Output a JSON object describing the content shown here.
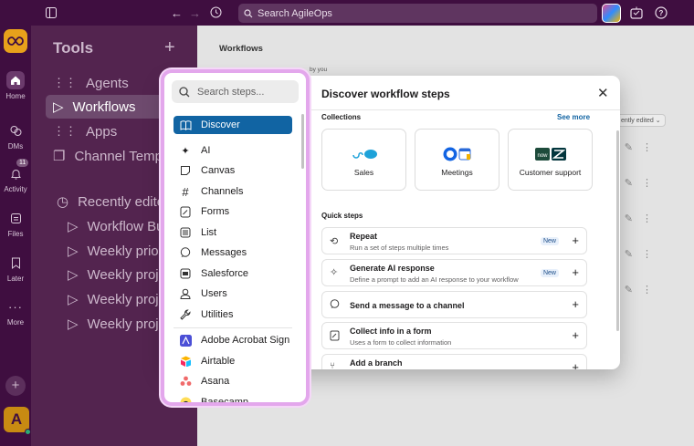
{
  "topbar": {
    "search_placeholder": "Search AgileOps"
  },
  "rail": {
    "items": [
      {
        "label": "Home"
      },
      {
        "label": "DMs"
      },
      {
        "label": "Activity",
        "badge": "11"
      },
      {
        "label": "Files"
      },
      {
        "label": "Later"
      },
      {
        "label": "More"
      }
    ],
    "avatar_letter": "A"
  },
  "sidebar": {
    "title": "Tools",
    "items": [
      "Agents",
      "Workflows",
      "Apps",
      "Channel Templa"
    ],
    "recent_label": "Recently edited",
    "recent_items": [
      "Workflow Bu",
      "Weekly prior",
      "Weekly proje",
      "Weekly proje",
      "Weekly proje"
    ]
  },
  "main": {
    "title": "Workflows",
    "sub": "by you",
    "sort_label": "ently edited"
  },
  "modal": {
    "title": "Discover workflow steps",
    "collections_label": "Collections",
    "see_more": "See more",
    "collections": [
      {
        "label": "Sales"
      },
      {
        "label": "Meetings"
      },
      {
        "label": "Customer support"
      }
    ],
    "quick_steps_label": "Quick steps",
    "quick_steps": [
      {
        "title": "Repeat",
        "desc": "Run a set of steps multiple times",
        "badge": "New"
      },
      {
        "title": "Generate AI response",
        "desc": "Define a prompt to add an AI response to your workflow",
        "badge": "New"
      },
      {
        "title": "Send a message to a channel",
        "desc": "",
        "badge": ""
      },
      {
        "title": "Collect info in a form",
        "desc": "Uses a form to collect information",
        "badge": ""
      },
      {
        "title": "Add a branch",
        "desc": "",
        "badge": ""
      }
    ]
  },
  "panel": {
    "search_placeholder": "Search steps...",
    "items": [
      "Discover",
      "AI",
      "Canvas",
      "Channels",
      "Forms",
      "List",
      "Messages",
      "Salesforce",
      "Users",
      "Utilities",
      "Adobe Acrobat Sign",
      "Airtable",
      "Asana",
      "Basecamp"
    ]
  },
  "colors": {
    "aubergine": "#3f0e40",
    "sidebar": "#53244f",
    "selected": "#1164a3",
    "panel_border": "#e3a7ec"
  }
}
